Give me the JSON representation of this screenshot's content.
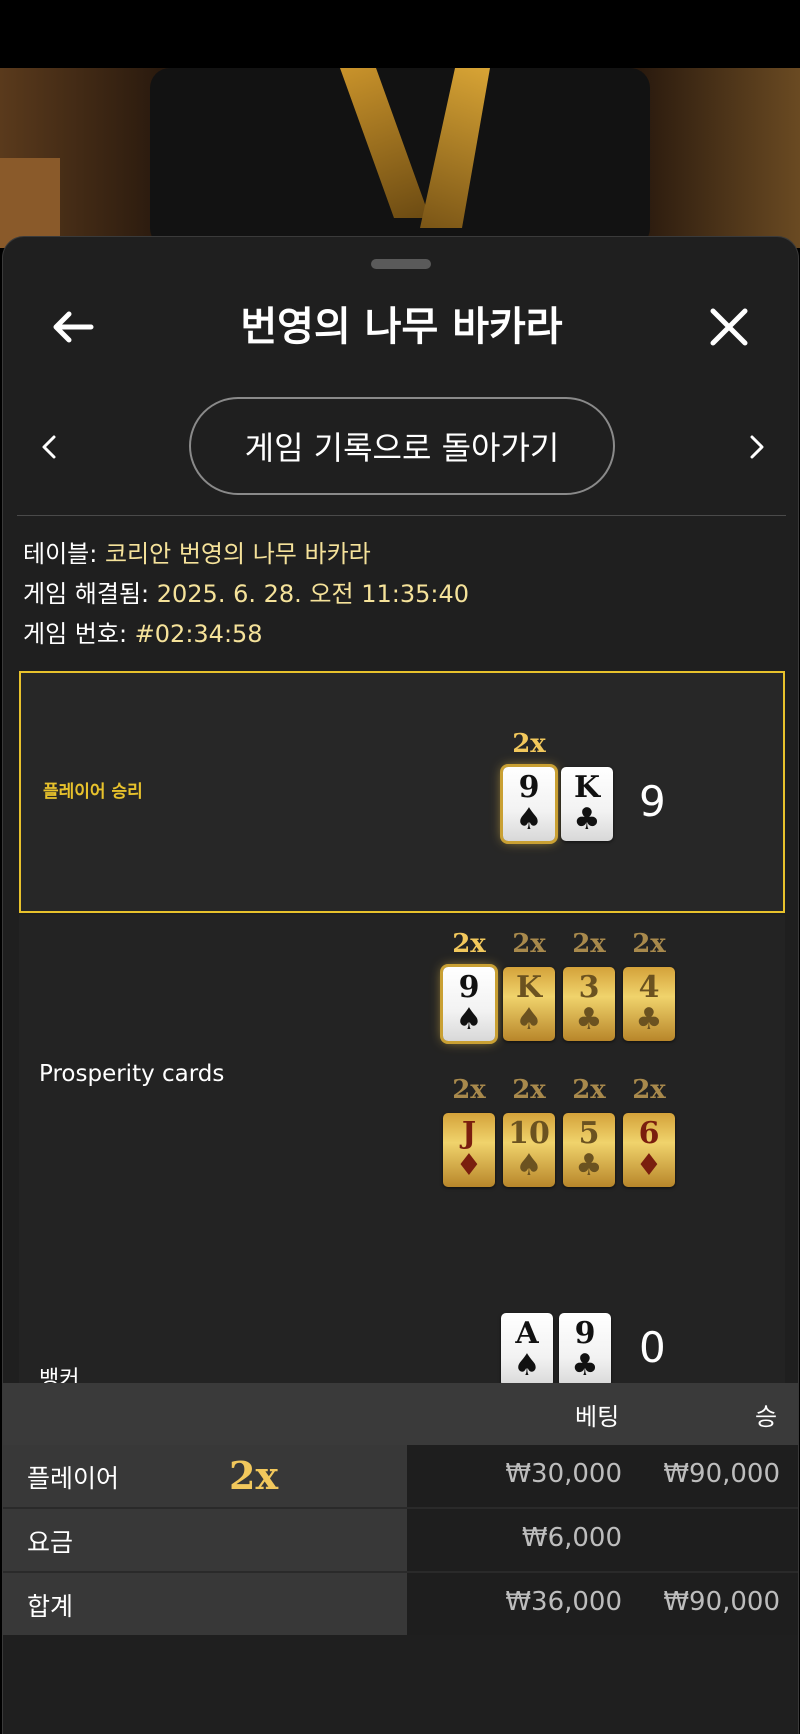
{
  "header": {
    "title": "번영의 나무 바카라"
  },
  "nav": {
    "history_button": "게임 기록으로 돌아가기"
  },
  "info": {
    "table_label": "테이블: ",
    "table_value": "코리안 번영의 나무 바카라",
    "resolved_label": "게임 해결됨: ",
    "resolved_value": "2025. 6. 28. 오전 11:35:40",
    "game_no_label": "게임 번호: ",
    "game_no_value": "#02:34:58"
  },
  "player": {
    "result_label": "플레이어 승리",
    "multiplier": "2x",
    "cards": [
      {
        "rank": "9",
        "suit": "♠",
        "highlight": true
      },
      {
        "rank": "K",
        "suit": "♣",
        "highlight": false
      }
    ],
    "score": "9"
  },
  "prosperity": {
    "label": "Prosperity cards",
    "row1": [
      {
        "mult": "2x",
        "rank": "9",
        "suit": "♠",
        "style": "white",
        "active": true
      },
      {
        "mult": "2x",
        "rank": "K",
        "suit": "♠",
        "style": "gold",
        "active": false
      },
      {
        "mult": "2x",
        "rank": "3",
        "suit": "♣",
        "style": "gold",
        "active": false
      },
      {
        "mult": "2x",
        "rank": "4",
        "suit": "♣",
        "style": "gold",
        "active": false
      }
    ],
    "row2": [
      {
        "mult": "2x",
        "rank": "J",
        "suit": "♦",
        "style": "gold",
        "red": true
      },
      {
        "mult": "2x",
        "rank": "10",
        "suit": "♠",
        "style": "gold",
        "red": false
      },
      {
        "mult": "2x",
        "rank": "5",
        "suit": "♣",
        "style": "gold",
        "red": false
      },
      {
        "mult": "2x",
        "rank": "6",
        "suit": "♦",
        "style": "gold",
        "red": true
      }
    ]
  },
  "banker": {
    "label": "뱅커",
    "cards": [
      {
        "rank": "A",
        "suit": "♠"
      },
      {
        "rank": "9",
        "suit": "♣"
      }
    ],
    "score": "0"
  },
  "bets_table": {
    "col_bet": "베팅",
    "col_win": "승",
    "rows": [
      {
        "name": "플레이어",
        "mult": "2x",
        "bet": "₩30,000",
        "win": "₩90,000"
      },
      {
        "name": "요금",
        "mult": "",
        "bet": "₩6,000",
        "win": ""
      },
      {
        "name": "합계",
        "mult": "",
        "bet": "₩36,000",
        "win": "₩90,000"
      }
    ]
  },
  "colors": {
    "accent_gold": "#e8c22c",
    "multiplier_gold": "#f2c85c",
    "info_value": "#f5e29a"
  },
  "icons": [
    "arrow-left-icon",
    "close-icon",
    "chevron-left-icon",
    "chevron-right-icon"
  ]
}
